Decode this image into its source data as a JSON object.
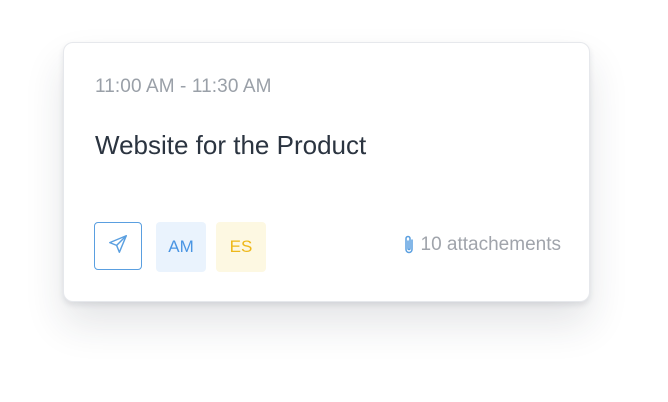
{
  "event": {
    "time_range": "11:00 AM - 11:30 AM",
    "title": "Website for the Product"
  },
  "actions": {
    "send_icon": "send-icon"
  },
  "assignees": [
    {
      "initials": "AM",
      "color": "#4a95e3",
      "background": "#eaf3fd"
    },
    {
      "initials": "ES",
      "color": "#eeb81a",
      "background": "#fdf8e2"
    }
  ],
  "attachments": {
    "icon": "paperclip-icon",
    "label": "10 attachements",
    "icon_color": "#5a9fe0"
  },
  "colors": {
    "accent": "#5a9fe0",
    "title_text": "#2b3440",
    "muted_text": "#9aa0a8"
  }
}
